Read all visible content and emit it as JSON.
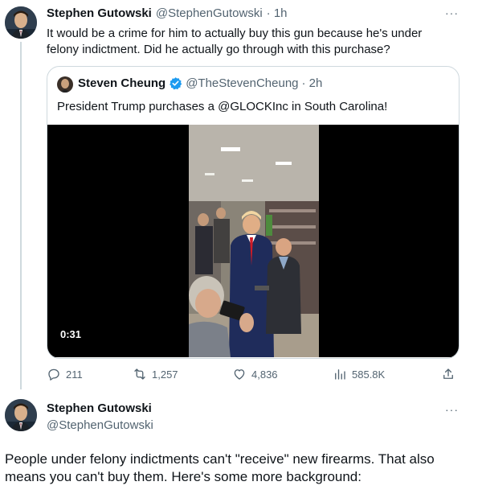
{
  "tweet1": {
    "name": "Stephen Gutowski",
    "handle": "@StephenGutowski",
    "time": "· 1h",
    "more": "···",
    "text": "It would be a crime for him to actually buy this gun because he's under felony indictment. Did he actually go through with this purchase?"
  },
  "quote": {
    "name": "Steven Cheung",
    "handle": "@TheStevenCheung",
    "time": "· 2h",
    "text": "President Trump purchases a @GLOCKInc in South Carolina!",
    "video_duration": "0:31"
  },
  "actions": {
    "replies": "211",
    "retweets": "1,257",
    "likes": "4,836",
    "views": "585.8K"
  },
  "tweet2": {
    "name": "Stephen Gutowski",
    "handle": "@StephenGutowski",
    "more": "···",
    "text": "People under felony indictments can't \"receive\" new firearms. That also means you can't buy them. Here's some more background:"
  },
  "colors": {
    "verified": "#1d9bf0",
    "muted": "#536471",
    "border": "#cfd9de"
  }
}
